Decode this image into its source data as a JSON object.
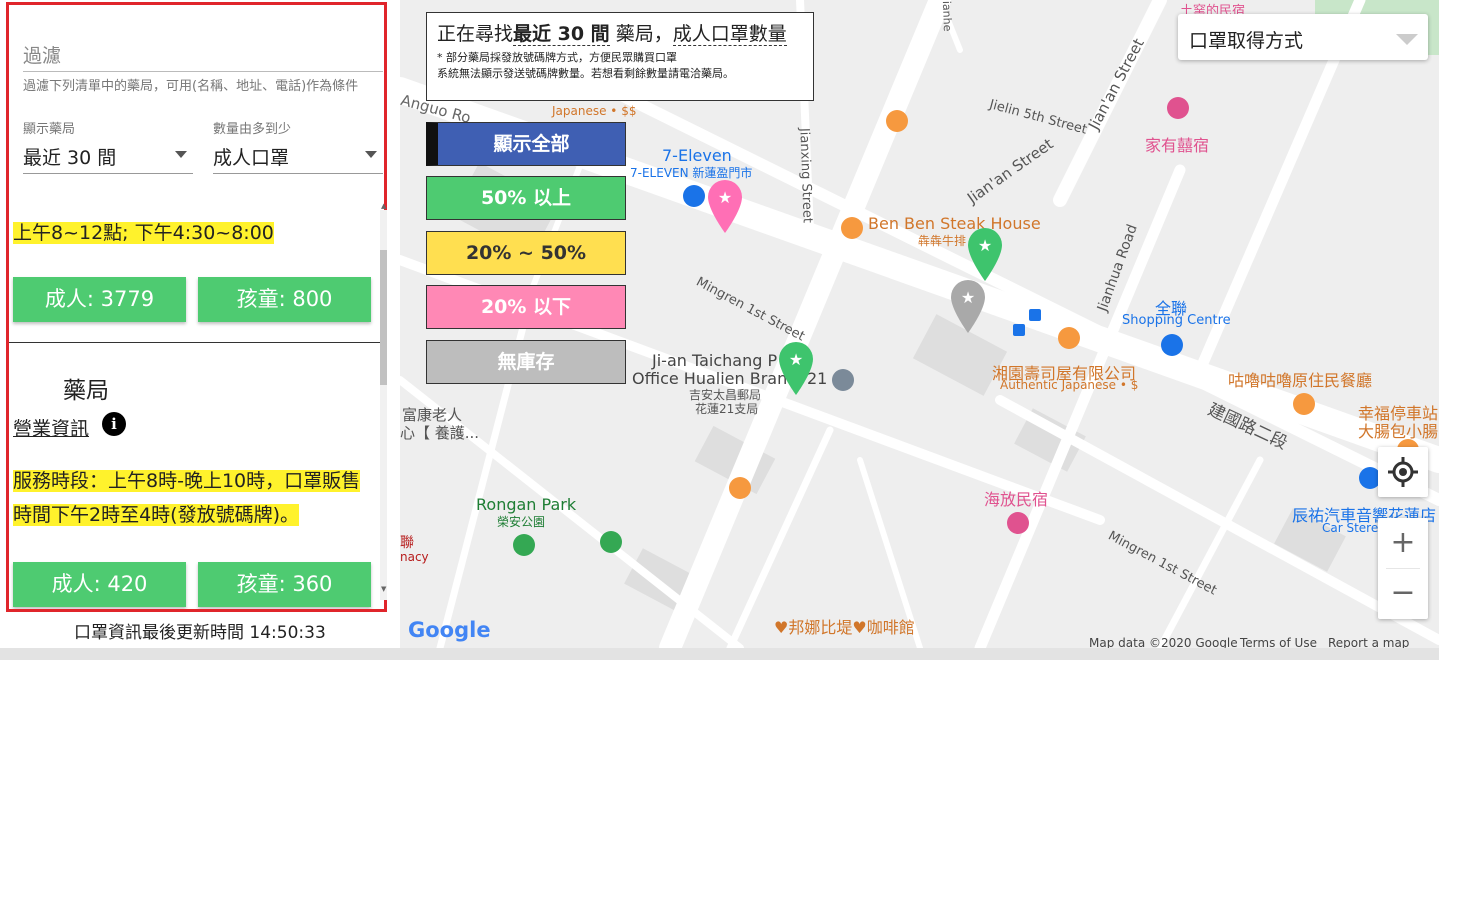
{
  "sidebar": {
    "filter_label": "過濾",
    "filter_hint": "過濾下列清單中的藥局，可用(名稱、地址、電話)作為條件",
    "show_caption": "顯示藥局",
    "show_value": "最近 30 間",
    "sort_caption": "數量由多到少",
    "sort_value": "成人口罩",
    "pharmacies": [
      {
        "name": "",
        "hours": "上午8~12點; 下午4:30~8:00",
        "adult": "成人: 3779",
        "child": "孩童: 800"
      },
      {
        "name": "藥局",
        "info_label": "營業資訊",
        "info_icon": "i",
        "hours": "服務時段：上午8時-晚上10時，口罩販售時間下午2時至4時(發放號碼牌)。",
        "adult": "成人: 420",
        "child": "孩童: 360"
      }
    ],
    "last_update": "口罩資訊最後更新時間 14:50:33"
  },
  "info_box": {
    "title_prefix": "正在尋找",
    "title_count": "最近 30 間",
    "title_mid": " 藥局，",
    "title_type": "成人口罩數量",
    "note1": "* 部分藥局採發放號碼牌方式，方便民眾購買口罩",
    "note2": "系統無法顯示發送號碼牌數量。若想看剩餘數量請電洽藥局。"
  },
  "legend": [
    {
      "label": "顯示全部",
      "color": "#3f5fb3",
      "text_color": "#ffffff"
    },
    {
      "label": "50% 以上",
      "color": "#4ecb71",
      "text_color": "#ffffff"
    },
    {
      "label": "20% ~ 50%",
      "color": "#ffdf50",
      "text_color": "#333333"
    },
    {
      "label": "20% 以下",
      "color": "#ff88b5",
      "text_color": "#ffffff"
    },
    {
      "label": "無庫存",
      "color": "#bdbdbd",
      "text_color": "#ffffff"
    }
  ],
  "mask_select": {
    "value": "口罩取得方式"
  },
  "map": {
    "streets": [
      "Jielin 5th Street",
      "Jian'an Street",
      "Jian'an Street",
      "Jianxing Street",
      "Jianhua Road",
      "Mingren 1st Street",
      "Mingren 1st Street",
      "建國路二段",
      "Jianhe"
    ],
    "places": [
      {
        "name": "7-Eleven",
        "sub": "7-ELEVEN 新蓮盈門市"
      },
      {
        "name": "Ben Ben Steak House",
        "sub": "犇犇牛排"
      },
      {
        "name": "家有囍宿",
        "sub": ""
      },
      {
        "name": "全聯",
        "sub": "Shopping Centre"
      },
      {
        "name": "湘園壽司屋有限公司",
        "sub": "Authentic Japanese • $"
      },
      {
        "name": "咕嚕咕嚕原住民餐廳",
        "sub": ""
      },
      {
        "name": "幸福停車站",
        "sub": "大腸包小腸"
      },
      {
        "name": "Ji-an Taichang P",
        "sub": "Office Hualien Branc"
      },
      {
        "name": "吉安太昌郵局",
        "sub": "花蓮21支局"
      },
      {
        "name": "富康老人",
        "sub": "心【 養護..."
      },
      {
        "name": "Rongan Park",
        "sub": "榮安公園"
      },
      {
        "name": "海放民宿",
        "sub": ""
      },
      {
        "name": "辰祐汽車音響花蓮店",
        "sub": "Car Stere"
      },
      {
        "name": "邦娜比堤",
        "sub": "咖啡館"
      },
      {
        "name": "Japanese • $$",
        "sub": ""
      },
      {
        "name": "聯",
        "sub": "nacy"
      },
      {
        "name": "Anguo Ro",
        "sub": ""
      },
      {
        "name": "21",
        "sub": ""
      },
      {
        "name": "土窯的民宿",
        "sub": ""
      }
    ],
    "attribution": "Map data ©2020 Google",
    "terms": "Terms of Use",
    "report": "Report a map error",
    "google": "Google"
  }
}
